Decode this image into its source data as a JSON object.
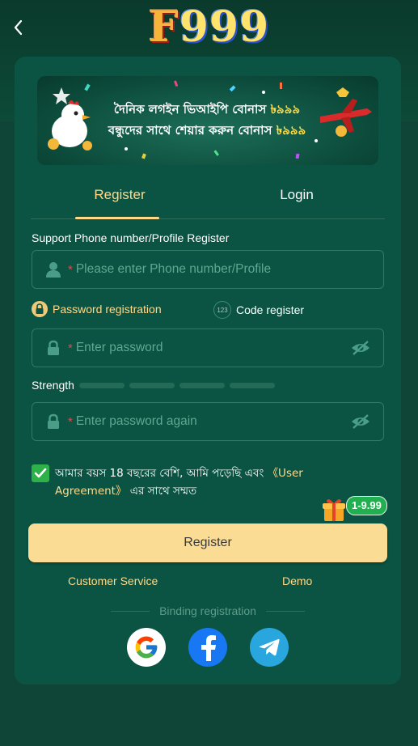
{
  "header": {
    "logo_text_f": "F",
    "logo_text_num": "999"
  },
  "banner": {
    "line1_text": "দৈনিক লগইন ভিআইপি বোনাস ",
    "line1_amount": "৳৯৯৯",
    "line2_text": "বন্ধুদের সাথে শেয়ার করুন বোনাস ",
    "line2_amount": "৳৯৯৯"
  },
  "tabs": {
    "register": "Register",
    "login": "Login"
  },
  "form": {
    "phone_label": "Support Phone number/Profile Register",
    "phone_required": "*",
    "phone_placeholder": "Please enter Phone number/Profile",
    "option_password": "Password registration",
    "option_code": "Code register",
    "option_code_icon_text": "123",
    "password_required": "*",
    "password_placeholder": "Enter password",
    "strength_label": "Strength",
    "password2_required": "*",
    "password2_placeholder": "Enter password again",
    "agree_text": "আমার বয়স 18 বছরের বেশি, আমি পড়েছি এবং ",
    "agree_link": "《User Agreement》",
    "agree_text_end": " এর সাথে সম্মত",
    "agreement_checked": true
  },
  "promo_badge": "1-9.99",
  "register_button": "Register",
  "links": {
    "customer_service": "Customer Service",
    "demo": "Demo"
  },
  "binding_label": "Binding registration",
  "social": [
    "google-icon",
    "facebook-icon",
    "telegram-icon"
  ],
  "colors": {
    "accent": "#ffd98a",
    "background": "#0f4536",
    "card": "#0b5443",
    "button": "#fbdc94",
    "success": "#2fb14a"
  }
}
